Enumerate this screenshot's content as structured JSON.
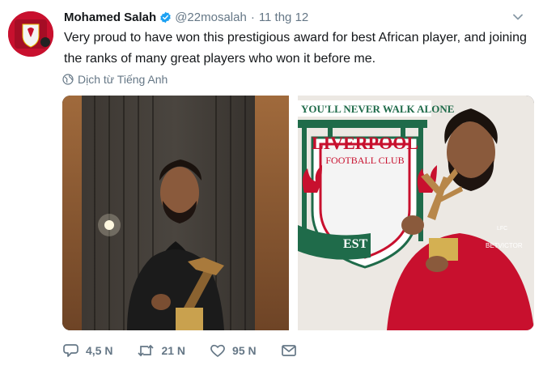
{
  "tweet": {
    "author_name": "Mohamed Salah",
    "handle": "@22mosalah",
    "separator": "·",
    "timestamp": "11 thg 12",
    "text": "Very proud to have won this prestigious award for best African player, and joining the ranks of many great players who won it before me.",
    "translate_label": "Dịch từ Tiếng Anh"
  },
  "photo2": {
    "banner_text": "YOU'LL NEVER WALK ALONE",
    "crest_line1": "LIVERPOOL",
    "crest_line2": "FOOTBALL CLUB",
    "crest_est": "EST",
    "shirt_sponsor": "BETVICTOR",
    "shirt_badge": "LFC"
  },
  "actions": {
    "reply_count": "4,5 N",
    "retweet_count": "21 N",
    "like_count": "95 N"
  },
  "colors": {
    "brand_blue": "#1da1f2",
    "lfc_red": "#c8102e",
    "muted": "#657786"
  },
  "icons": [
    "verified-badge-icon",
    "chevron-down-icon",
    "globe-icon",
    "reply-icon",
    "retweet-icon",
    "like-icon",
    "direct-message-icon"
  ]
}
